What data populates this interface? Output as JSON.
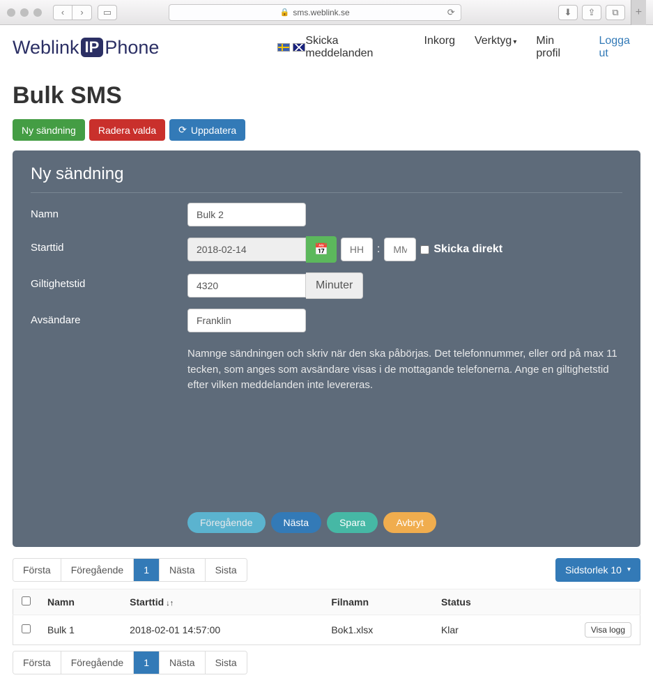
{
  "browser": {
    "url": "sms.weblink.se"
  },
  "logo": {
    "pre": "Weblink",
    "ip": "IP",
    "post": "Phone"
  },
  "nav": {
    "skicka": "Skicka meddelanden",
    "inkorg": "Inkorg",
    "verktyg": "Verktyg",
    "profil": "Min profil",
    "logga": "Logga ut"
  },
  "page": {
    "title": "Bulk SMS"
  },
  "actions": {
    "ny": "Ny sändning",
    "radera": "Radera valda",
    "uppdatera": "Uppdatera"
  },
  "form": {
    "title": "Ny sändning",
    "labels": {
      "namn": "Namn",
      "starttid": "Starttid",
      "giltighet": "Giltighetstid",
      "avsandare": "Avsändare"
    },
    "values": {
      "namn": "Bulk 2",
      "date": "2018-02-14",
      "validity": "4320",
      "sender": "Franklin"
    },
    "placeholders": {
      "hh": "HH",
      "mm": "MM"
    },
    "addon": {
      "min": "Minuter"
    },
    "skicka_direkt": "Skicka direkt",
    "help": "Namnge sändningen och skriv när den ska påbörjas. Det telefonnummer, eller ord på max 11 tecken, som anges som avsändare visas i de mottagande telefonerna. Ange en giltighetstid efter vilken meddelanden inte levereras."
  },
  "wizard": {
    "prev": "Föregående",
    "next": "Nästa",
    "save": "Spara",
    "cancel": "Avbryt"
  },
  "pager": {
    "first": "Första",
    "prev": "Föregående",
    "page": "1",
    "next": "Nästa",
    "last": "Sista",
    "size": "Sidstorlek 10"
  },
  "table": {
    "head": {
      "namn": "Namn",
      "starttid": "Starttid",
      "filnamn": "Filnamn",
      "status": "Status"
    },
    "rows": [
      {
        "namn": "Bulk 1",
        "starttid": "2018-02-01 14:57:00",
        "filnamn": "Bok1.xlsx",
        "status": "Klar",
        "action": "Visa logg"
      }
    ]
  }
}
